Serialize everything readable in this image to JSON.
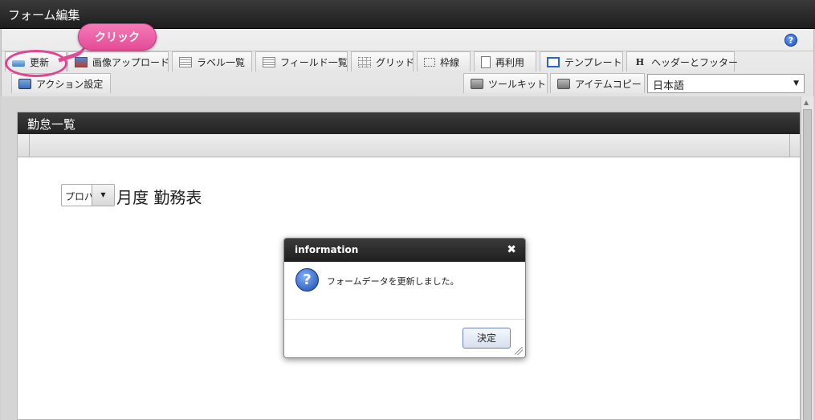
{
  "window": {
    "title": "フォーム編集"
  },
  "callout": {
    "label": "クリック"
  },
  "toolbar": {
    "row1": [
      {
        "label": "更新",
        "icon": "update-icon"
      },
      {
        "label": "画像アップロード",
        "icon": "image-upload-icon"
      },
      {
        "label": "ラベル一覧",
        "icon": "label-list-icon"
      },
      {
        "label": "フィールド一覧",
        "icon": "field-list-icon"
      },
      {
        "label": "グリッド",
        "icon": "grid-icon"
      },
      {
        "label": "枠線",
        "icon": "border-icon"
      },
      {
        "label": "再利用",
        "icon": "reuse-icon"
      },
      {
        "label": "テンプレート",
        "icon": "template-icon"
      },
      {
        "label": "ヘッダーとフッター",
        "icon": "header-footer-icon"
      }
    ],
    "row2": [
      {
        "label": "アクション設定",
        "icon": "action-settings-icon"
      },
      {
        "label": "ツールキット",
        "icon": "toolkit-icon"
      },
      {
        "label": "アイテムコピー",
        "icon": "item-copy-icon"
      }
    ],
    "language": "日本語",
    "help_symbol": "?"
  },
  "panel": {
    "title": "勤怠一覧",
    "period_select_value": "プロパ",
    "form_title": "月度 勤務表"
  },
  "dialog": {
    "title": "information",
    "message": "フォームデータを更新しました。",
    "ok_label": "決定",
    "icon_symbol": "?"
  },
  "colors": {
    "accent_pink": "#e24c97",
    "header_dark": "#222222"
  }
}
